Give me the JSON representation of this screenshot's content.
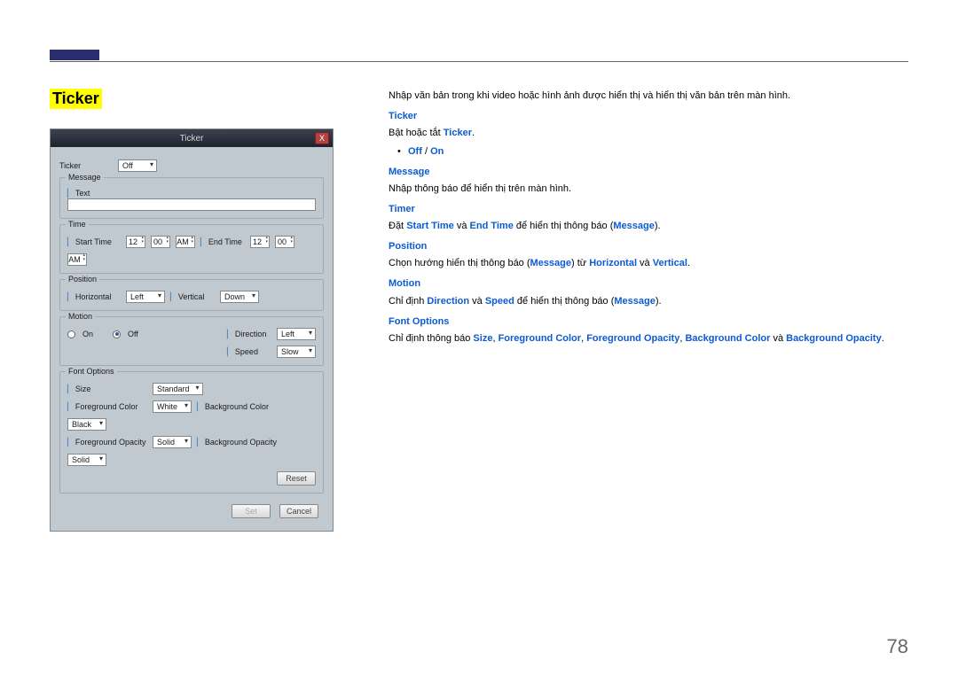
{
  "page": {
    "title": "Ticker",
    "number": "78"
  },
  "dialog": {
    "title": "Ticker",
    "close": "X",
    "ticker_label": "Ticker",
    "ticker_value": "Off",
    "message_group": "Message",
    "message_label": "Text",
    "time_group": "Time",
    "start_time_label": "Start Time",
    "st_h": "12",
    "st_m": "00",
    "st_ampm": "AM",
    "end_time_label": "End Time",
    "et_h": "12",
    "et_m": "00",
    "et_ampm": "AM",
    "position_group": "Position",
    "horizontal_label": "Horizontal",
    "horizontal_value": "Left",
    "vertical_label": "Vertical",
    "vertical_value": "Down",
    "motion_group": "Motion",
    "motion_on": "On",
    "motion_off": "Off",
    "direction_label": "Direction",
    "direction_value": "Left",
    "speed_label": "Speed",
    "speed_value": "Slow",
    "font_group": "Font Options",
    "size_label": "Size",
    "size_value": "Standard",
    "fgcolor_label": "Foreground Color",
    "fgcolor_value": "White",
    "fgop_label": "Foreground Opacity",
    "fgop_value": "Solid",
    "bgcolor_label": "Background Color",
    "bgcolor_value": "Black",
    "bgop_label": "Background Opacity",
    "bgop_value": "Solid",
    "reset": "Reset",
    "set": "Set",
    "cancel": "Cancel"
  },
  "doc": {
    "intro": "Nhập văn bản trong khi video hoặc hình ảnh được hiển thị và hiển thị văn bản trên màn hình.",
    "ticker_h": "Ticker",
    "ticker_pre": "Bật hoặc tắt ",
    "ticker_kw": "Ticker",
    "period": ".",
    "off": "Off",
    "slash": " / ",
    "on": "On",
    "message_h": "Message",
    "message_txt": "Nhập thông báo để hiển thị trên màn hình.",
    "timer_h": "Timer",
    "timer_pre": "Đặt ",
    "timer_start": "Start Time",
    "va": " và ",
    "timer_end": "End Time",
    "timer_post": " để hiển thị thông báo (",
    "msg_kw": "Message",
    "close_paren": ").",
    "position_h": "Position",
    "pos_pre": "Chọn hướng hiển thị thông báo (",
    "from": ") từ ",
    "horiz": "Horizontal",
    "vert": "Vertical",
    "motion_h": "Motion",
    "motion_pre": "Chỉ định ",
    "dir": "Direction",
    "speed": "Speed",
    "motion_post": " để hiển thị thông báo (",
    "font_h": "Font Options",
    "font_pre": "Chỉ định thông báo ",
    "size": "Size",
    "fgc": "Foreground Color",
    "fgo": "Foreground Opacity",
    "bgc": "Background Color",
    "bgo": "Background Opacity",
    "comma": ", "
  }
}
